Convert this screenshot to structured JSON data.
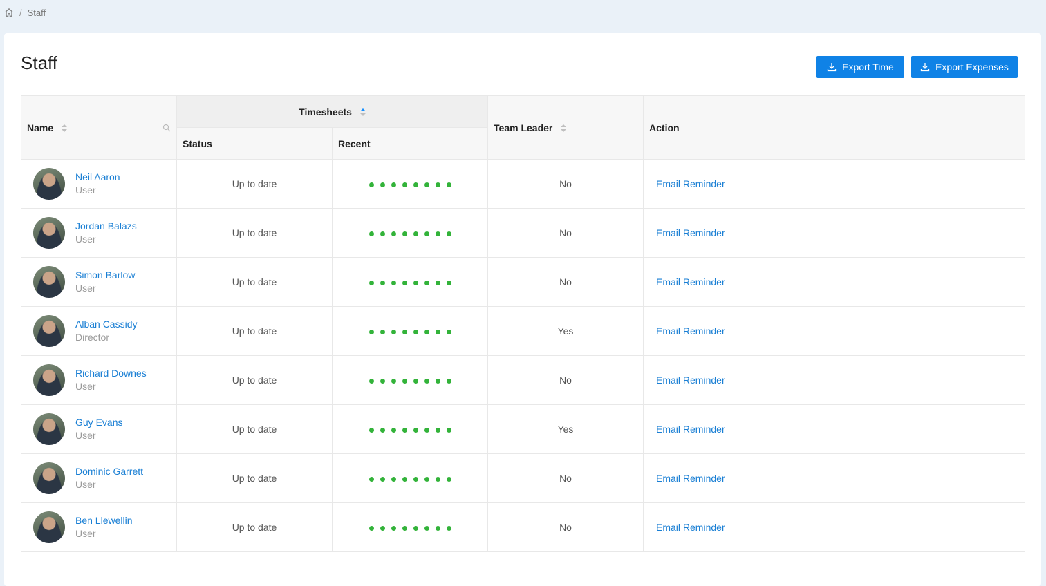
{
  "breadcrumb": {
    "current": "Staff",
    "separator": "/"
  },
  "page": {
    "title": "Staff"
  },
  "buttons": {
    "export_time": "Export Time",
    "export_expenses": "Export Expenses"
  },
  "table": {
    "headers": {
      "name": "Name",
      "timesheets": "Timesheets",
      "status": "Status",
      "recent": "Recent",
      "team_leader": "Team Leader",
      "action": "Action"
    },
    "rows": [
      {
        "name": "Neil Aaron",
        "role": "User",
        "status": "Up to date",
        "recent_ok": 8,
        "team_leader": "No",
        "action": "Email Reminder"
      },
      {
        "name": "Jordan Balazs",
        "role": "User",
        "status": "Up to date",
        "recent_ok": 8,
        "team_leader": "No",
        "action": "Email Reminder"
      },
      {
        "name": "Simon Barlow",
        "role": "User",
        "status": "Up to date",
        "recent_ok": 8,
        "team_leader": "No",
        "action": "Email Reminder"
      },
      {
        "name": "Alban Cassidy",
        "role": "Director",
        "status": "Up to date",
        "recent_ok": 8,
        "team_leader": "Yes",
        "action": "Email Reminder"
      },
      {
        "name": "Richard Downes",
        "role": "User",
        "status": "Up to date",
        "recent_ok": 8,
        "team_leader": "No",
        "action": "Email Reminder"
      },
      {
        "name": "Guy Evans",
        "role": "User",
        "status": "Up to date",
        "recent_ok": 8,
        "team_leader": "Yes",
        "action": "Email Reminder"
      },
      {
        "name": "Dominic Garrett",
        "role": "User",
        "status": "Up to date",
        "recent_ok": 8,
        "team_leader": "No",
        "action": "Email Reminder"
      },
      {
        "name": "Ben Llewellin",
        "role": "User",
        "status": "Up to date",
        "recent_ok": 8,
        "team_leader": "No",
        "action": "Email Reminder"
      }
    ]
  },
  "colors": {
    "accent": "#0f82e6",
    "link": "#1a7fd4",
    "ok_dot": "#33b33a"
  }
}
